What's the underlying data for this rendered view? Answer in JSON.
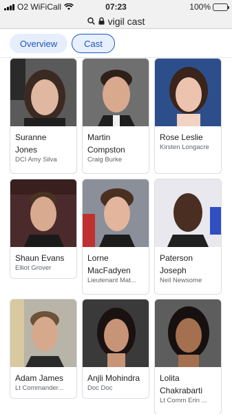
{
  "status_bar": {
    "carrier": "O2 WiFiCall",
    "time": "07:23",
    "battery": "100%",
    "battery_level": 1.0
  },
  "url_bar": {
    "query": "vigil cast",
    "icons": [
      "search-icon",
      "lock-icon"
    ]
  },
  "tabs": [
    {
      "label": "Overview",
      "selected": false
    },
    {
      "label": "Cast",
      "selected": true
    }
  ],
  "colors": {
    "accent": "#1a56c4",
    "tab_bg": "#e6eefb",
    "battery_green": "#4cd964"
  },
  "cast": [
    {
      "name_line1": "Suranne",
      "name_line2": "Jones",
      "role": "DCI Amy Silva"
    },
    {
      "name_line1": "Martin",
      "name_line2": "Compston",
      "role": "Craig Burke"
    },
    {
      "name_line1": "Rose Leslie",
      "name_line2": "",
      "role": "Kirsten Longacre"
    },
    {
      "name_line1": "Shaun Evans",
      "name_line2": "",
      "role": "Elliot Grover"
    },
    {
      "name_line1": "Lorne",
      "name_line2": "MacFadyen",
      "role": "Lieutenant Mat..."
    },
    {
      "name_line1": "Paterson",
      "name_line2": "Joseph",
      "role": "Neil Newsome"
    },
    {
      "name_line1": "Adam James",
      "name_line2": "",
      "role": "Lt Commander..."
    },
    {
      "name_line1": "Anjli Mohindra",
      "name_line2": "",
      "role": "Doc Doc"
    },
    {
      "name_line1": "Lolita",
      "name_line2": "Chakrabarti",
      "role": "Lt Comm Erin ..."
    }
  ]
}
